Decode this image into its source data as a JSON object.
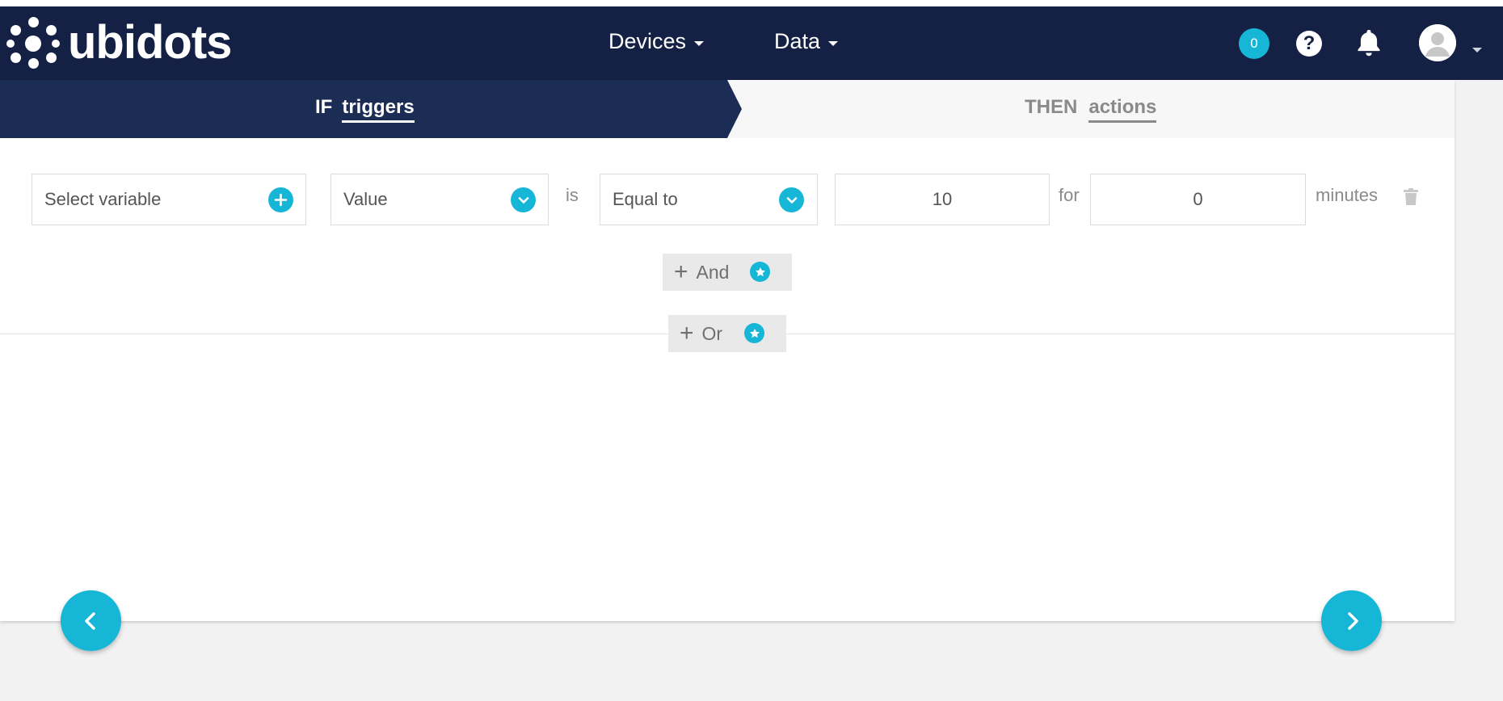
{
  "brand": {
    "name": "ubidots"
  },
  "nav": {
    "devices_label": "Devices",
    "data_label": "Data",
    "notification_count": "0",
    "help_glyph": "?"
  },
  "steps": {
    "if_prefix": "IF",
    "if_word": "triggers",
    "then_prefix": "THEN",
    "then_word": "actions"
  },
  "condition": {
    "variable_placeholder": "Select variable",
    "aggregation": "Value",
    "is_label": "is",
    "operator": "Equal to",
    "value": "10",
    "for_label": "for",
    "duration": "0",
    "unit_label": "minutes"
  },
  "logic": {
    "and_label": "And",
    "or_label": "Or"
  },
  "colors": {
    "navbar": "#142145",
    "accent": "#16b6d6",
    "step_active": "#1b2c55"
  },
  "icons": [
    "bell-icon",
    "help-icon",
    "avatar-icon",
    "plus-icon",
    "chevron-down-icon",
    "trash-icon",
    "star-icon",
    "chevron-left-icon",
    "chevron-right-icon"
  ]
}
